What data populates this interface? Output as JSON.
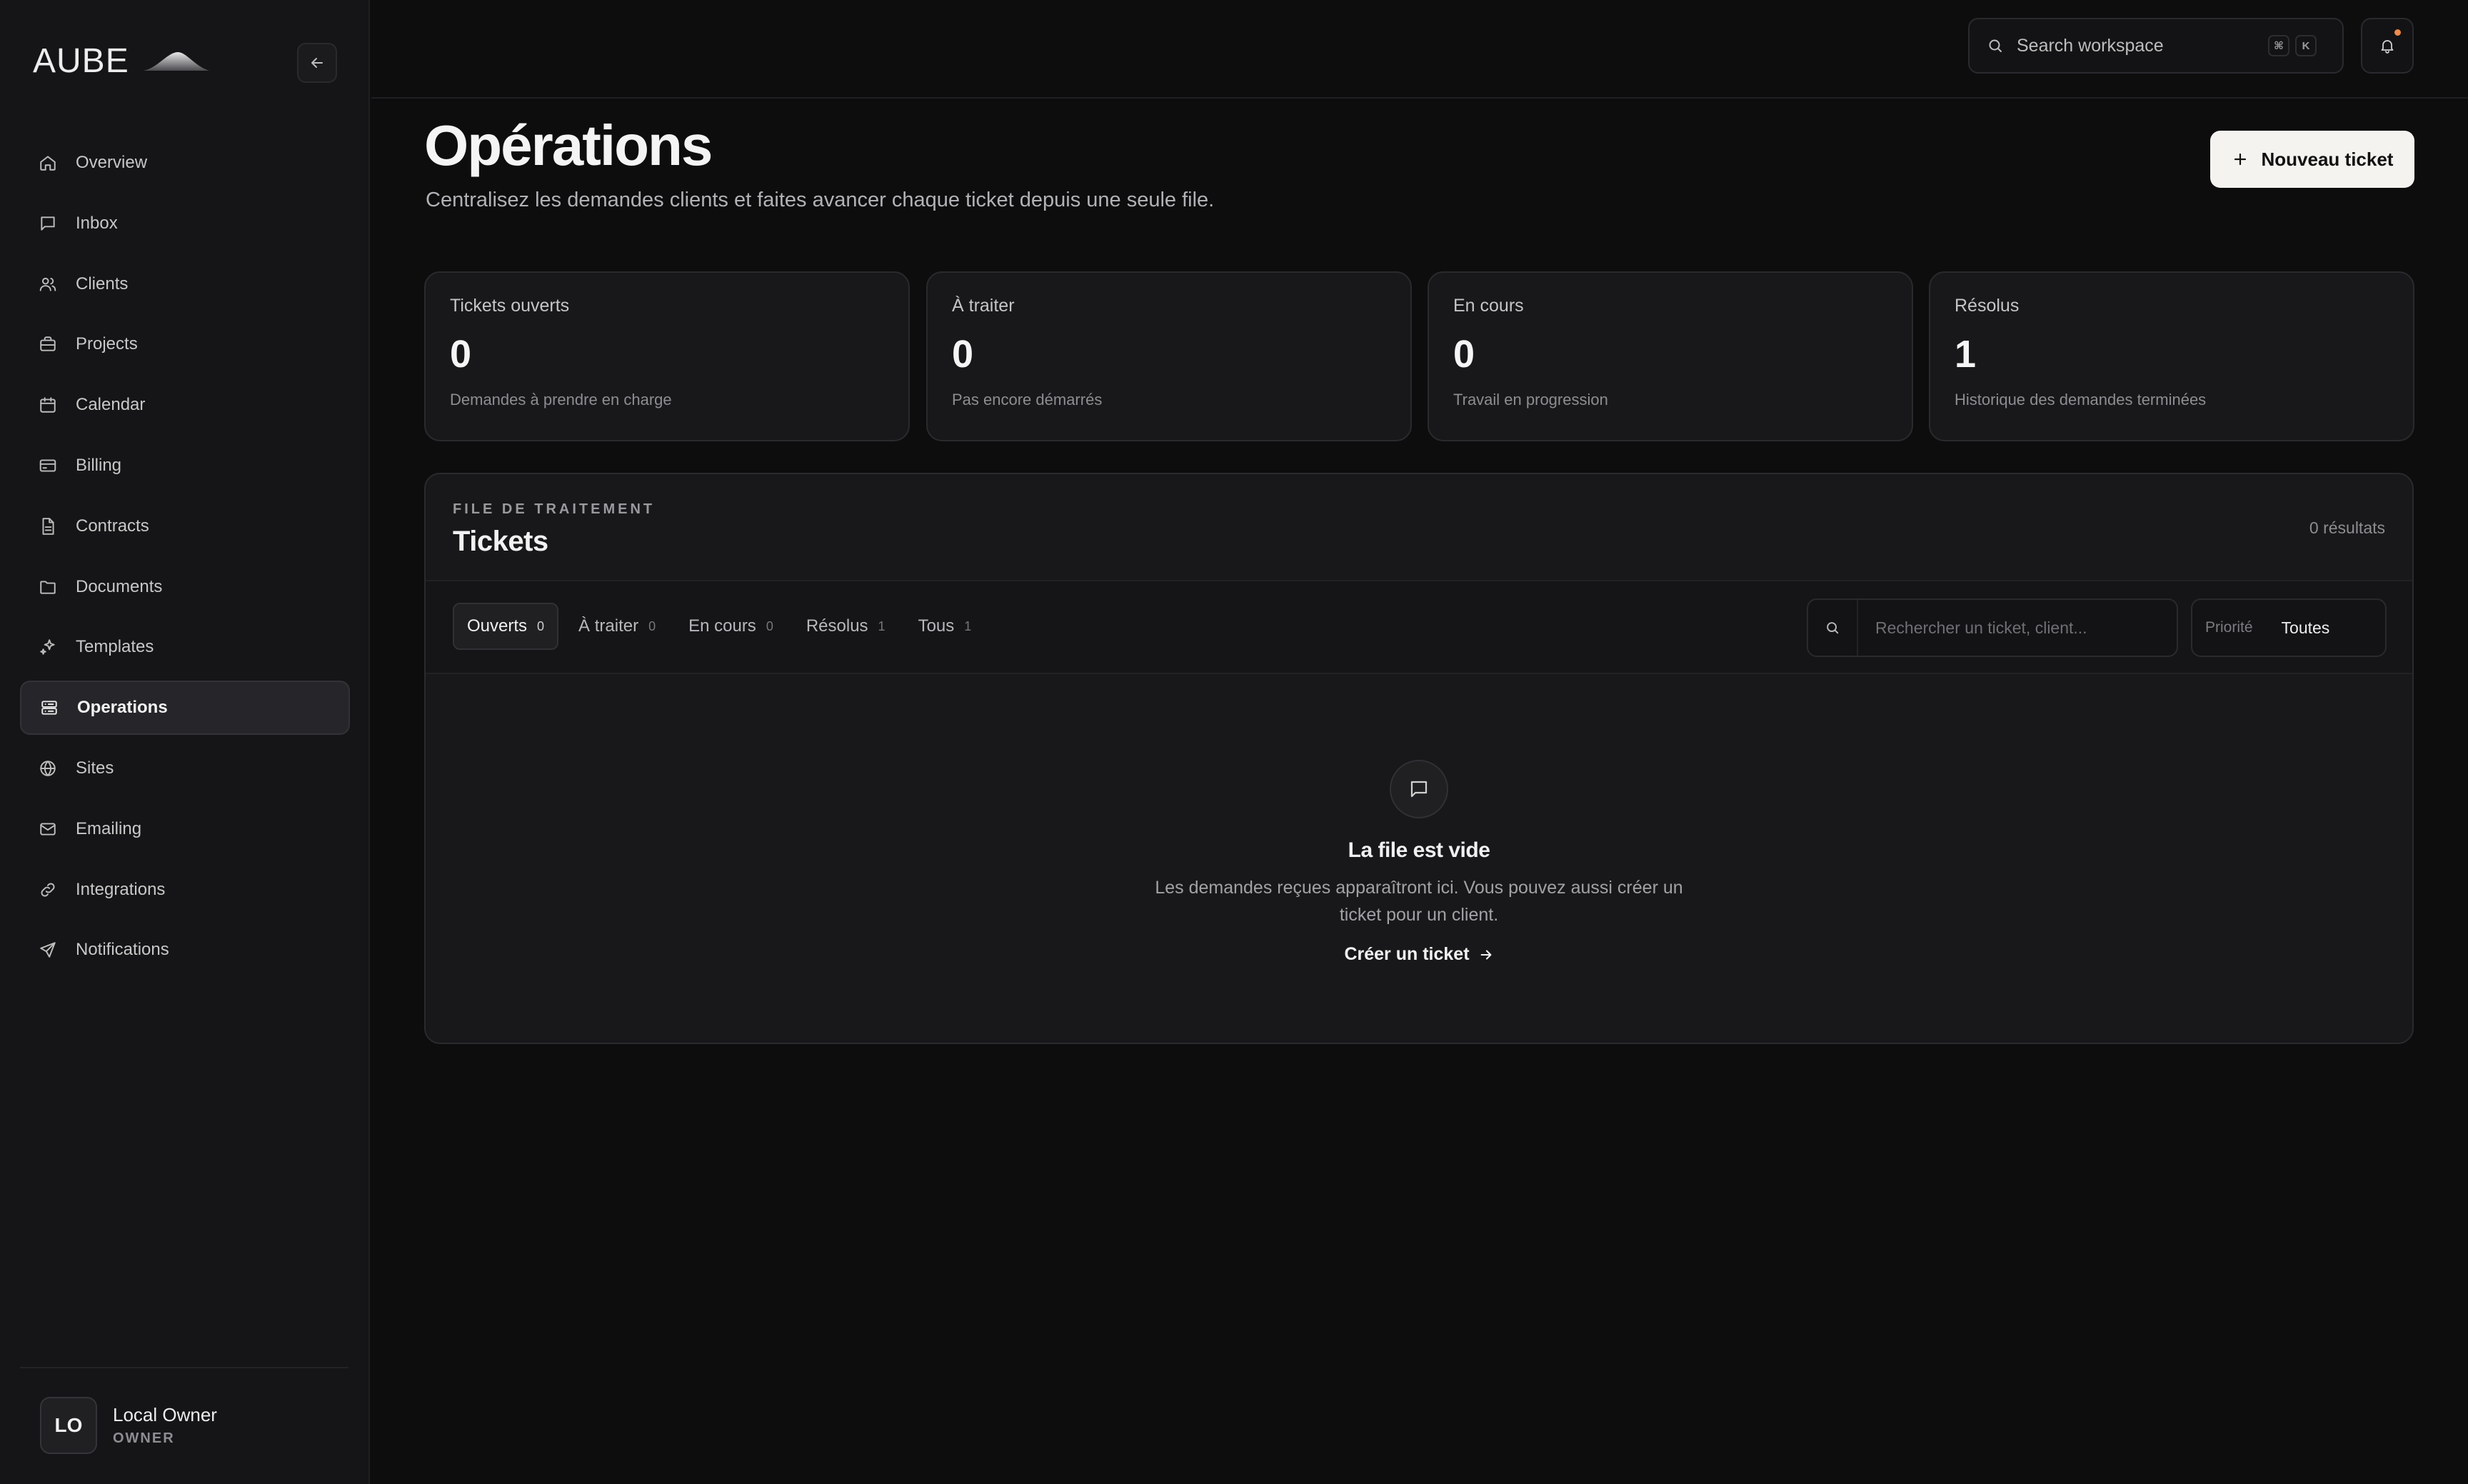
{
  "brand": {
    "name": "AUBE"
  },
  "sidebar": {
    "items": [
      {
        "label": "Overview",
        "icon": "home-icon"
      },
      {
        "label": "Inbox",
        "icon": "message-icon"
      },
      {
        "label": "Clients",
        "icon": "users-icon"
      },
      {
        "label": "Projects",
        "icon": "briefcase-icon"
      },
      {
        "label": "Calendar",
        "icon": "calendar-icon"
      },
      {
        "label": "Billing",
        "icon": "credit-card-icon"
      },
      {
        "label": "Contracts",
        "icon": "file-text-icon"
      },
      {
        "label": "Documents",
        "icon": "folder-icon"
      },
      {
        "label": "Templates",
        "icon": "sparkles-icon"
      },
      {
        "label": "Operations",
        "icon": "server-icon",
        "active": true
      },
      {
        "label": "Sites",
        "icon": "globe-icon"
      },
      {
        "label": "Emailing",
        "icon": "mail-icon"
      },
      {
        "label": "Integrations",
        "icon": "link-icon"
      },
      {
        "label": "Notifications",
        "icon": "send-icon"
      }
    ],
    "user": {
      "initials": "LO",
      "name": "Local Owner",
      "role": "OWNER"
    }
  },
  "topbar": {
    "search_placeholder": "Search workspace",
    "shortcut": [
      "⌘",
      "K"
    ]
  },
  "header": {
    "title": "Opérations",
    "subtitle": "Centralisez les demandes clients et faites avancer chaque ticket depuis une seule file.",
    "new_ticket_label": "Nouveau ticket"
  },
  "stats": [
    {
      "label": "Tickets ouverts",
      "value": "0",
      "desc": "Demandes à prendre en charge"
    },
    {
      "label": "À traiter",
      "value": "0",
      "desc": "Pas encore démarrés"
    },
    {
      "label": "En cours",
      "value": "0",
      "desc": "Travail en progression"
    },
    {
      "label": "Résolus",
      "value": "1",
      "desc": "Historique des demandes terminées"
    }
  ],
  "panel": {
    "eyebrow": "FILE DE TRAITEMENT",
    "title": "Tickets",
    "count": "0 résultats",
    "tabs": [
      {
        "label": "Ouverts",
        "count": "0"
      },
      {
        "label": "À traiter",
        "count": "0"
      },
      {
        "label": "En cours",
        "count": "0"
      },
      {
        "label": "Résolus",
        "count": "1"
      },
      {
        "label": "Tous",
        "count": "1"
      }
    ],
    "search_placeholder": "Rechercher un ticket, client...",
    "priority_label": "Priorité",
    "priority_value": "Toutes",
    "empty": {
      "title": "La file est vide",
      "text": "Les demandes reçues apparaîtront ici. Vous pouvez aussi créer un ticket pour un client.",
      "link": "Créer un ticket"
    }
  },
  "colors": {
    "background": "#0d0d0e",
    "sidebar": "#151517",
    "card": "#18181a",
    "accent_button": "#f4f3ef",
    "notification_dot": "#f08a4b"
  }
}
